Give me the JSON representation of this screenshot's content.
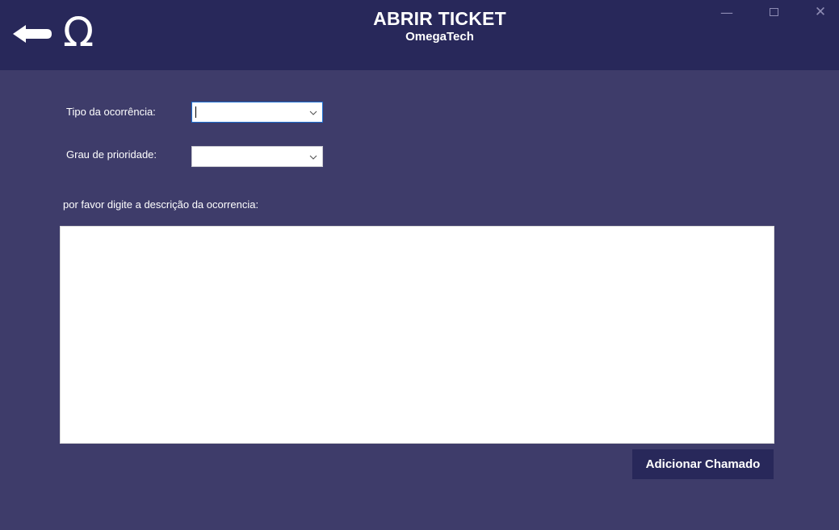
{
  "header": {
    "title": "ABRIR TICKET",
    "subtitle": "OmegaTech",
    "logo_symbol": "Ω",
    "back_icon": "arrow-left-icon",
    "bg_color": "#28285a"
  },
  "window_controls": {
    "minimize": "—",
    "close": "✕"
  },
  "form": {
    "tipo_label": "Tipo da ocorrência:",
    "tipo_value": "",
    "prioridade_label": "Grau de prioridade:",
    "prioridade_value": "",
    "descricao_label": "por favor digite a descrição da ocorrencia:",
    "descricao_value": "",
    "submit_label": "Adicionar Chamado"
  },
  "colors": {
    "background": "#3e3c6a",
    "accent": "#28285a",
    "focus": "#1e70d2"
  }
}
